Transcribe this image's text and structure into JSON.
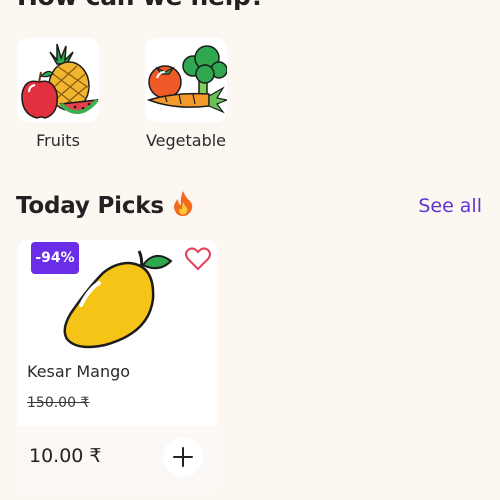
{
  "header": {
    "title": "How can we help?"
  },
  "categories": [
    {
      "label": "Fruits",
      "icon": "fruits-icon"
    },
    {
      "label": "Vegetable",
      "icon": "vegetables-icon"
    }
  ],
  "section": {
    "title": "Today Picks",
    "icon": "fire-icon",
    "see_all": "See all"
  },
  "product": {
    "badge": "-94%",
    "name": "Kesar Mango",
    "old_price": "150.00 ₹",
    "price": "10.00 ₹",
    "image_icon": "mango-icon",
    "wishlist_icon": "heart-icon",
    "add_icon": "plus-icon"
  },
  "colors": {
    "accent": "#5a37d0",
    "badge": "#6a2ee8",
    "background": "#fdf7f2",
    "heart": "#e0405a"
  }
}
